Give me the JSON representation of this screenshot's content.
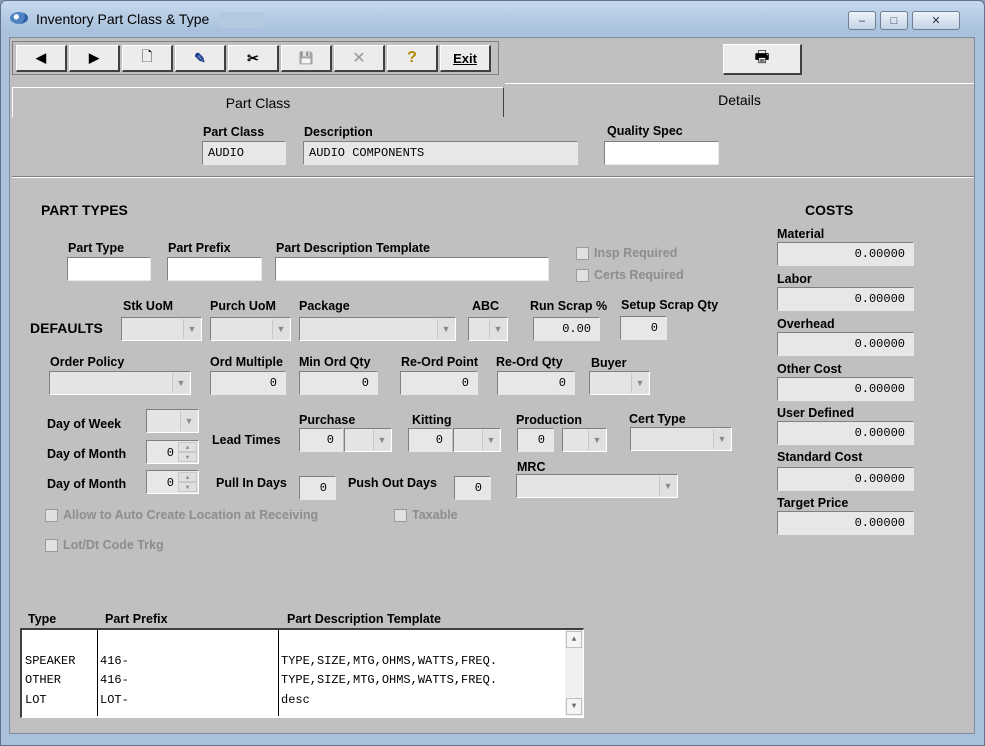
{
  "window": {
    "title": "Inventory Part Class & Type",
    "minimize": "–",
    "maximize": "□",
    "close": "✕"
  },
  "toolbar": {
    "prev": "◀",
    "next": "▶",
    "new": "🗋",
    "edit": "✎",
    "cut": "✂",
    "save": "💾",
    "delete": "✕",
    "help": "?",
    "exit": "Exit",
    "print": "🖶"
  },
  "tabs": {
    "part_class": "Part Class",
    "details": "Details"
  },
  "header": {
    "part_class_label": "Part Class",
    "part_class_value": "AUDIO",
    "description_label": "Description",
    "description_value": "AUDIO COMPONENTS",
    "quality_spec_label": "Quality Spec",
    "quality_spec_value": ""
  },
  "part_types": {
    "heading": "PART TYPES",
    "part_type_label": "Part Type",
    "part_prefix_label": "Part Prefix",
    "template_label": "Part Description Template",
    "insp_required": "Insp Required",
    "certs_required": "Certs Required"
  },
  "defaults": {
    "heading": "DEFAULTS",
    "stk_uom": "Stk UoM",
    "purch_uom": "Purch UoM",
    "package": "Package",
    "abc": "ABC",
    "run_scrap_label": "Run Scrap %",
    "run_scrap_value": "0.00",
    "setup_scrap_label": "Setup Scrap Qty",
    "setup_scrap_value": "0",
    "order_policy": "Order Policy",
    "ord_multiple_label": "Ord Multiple",
    "ord_multiple_value": "0",
    "min_ord_qty_label": "Min Ord Qty",
    "min_ord_qty_value": "0",
    "reord_point_label": "Re-Ord Point",
    "reord_point_value": "0",
    "reord_qty_label": "Re-Ord Qty",
    "reord_qty_value": "0",
    "buyer": "Buyer",
    "day_of_week": "Day of Week",
    "day_of_month_1": "Day of Month",
    "day_of_month_1_value": "0",
    "day_of_month_2": "Day of Month",
    "day_of_month_2_value": "0",
    "lead_times": "Lead Times",
    "purchase_label": "Purchase",
    "purchase_value": "0",
    "kitting_label": "Kitting",
    "kitting_value": "0",
    "production_label": "Production",
    "production_value": "0",
    "cert_type": "Cert Type",
    "pull_in_days_label": "Pull In Days",
    "pull_in_days_value": "0",
    "push_out_days_label": "Push Out Days",
    "push_out_days_value": "0",
    "mrc": "MRC",
    "allow_auto_create": "Allow to Auto Create Location at Receiving",
    "taxable": "Taxable",
    "lot_dt_code": "Lot/Dt Code Trkg"
  },
  "costs": {
    "heading": "COSTS",
    "items": [
      {
        "label": "Material",
        "value": "0.00000"
      },
      {
        "label": "Labor",
        "value": "0.00000"
      },
      {
        "label": "Overhead",
        "value": "0.00000"
      },
      {
        "label": "Other Cost",
        "value": "0.00000"
      },
      {
        "label": "User Defined",
        "value": "0.00000"
      },
      {
        "label": "Standard Cost",
        "value": "0.00000"
      },
      {
        "label": "Target Price",
        "value": "0.00000"
      }
    ]
  },
  "grid": {
    "headers": {
      "type": "Type",
      "prefix": "Part Prefix",
      "template": "Part Description Template"
    },
    "rows": [
      {
        "type": "SPEAKER",
        "prefix": "416-",
        "template": "TYPE,SIZE,MTG,OHMS,WATTS,FREQ."
      },
      {
        "type": "OTHER",
        "prefix": "416-",
        "template": "TYPE,SIZE,MTG,OHMS,WATTS,FREQ."
      },
      {
        "type": "LOT",
        "prefix": "LOT-",
        "template": "desc"
      }
    ]
  }
}
